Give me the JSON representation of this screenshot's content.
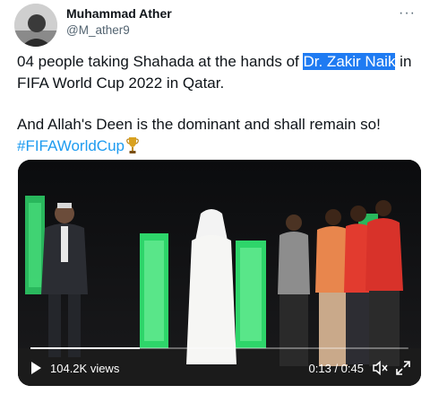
{
  "author": {
    "name": "Muhammad Ather",
    "handle": "@M_ather9",
    "avatar_icon": "profile-photo"
  },
  "menu": {
    "icon": "more-icon",
    "glyph": "···"
  },
  "tweet": {
    "text_before": "04 people taking Shahada at the hands of ",
    "highlight": "Dr. Zakir Naik",
    "text_after": " in FIFA World Cup 2022 in Qatar.",
    "line2": "And Allah's Deen is the dominant and shall remain so!",
    "hashtag": "#FIFAWorldCup",
    "emoji_icon": "trophy-icon"
  },
  "video": {
    "views": "104.2K views",
    "time": "0:13 / 0:45",
    "progress": 0.29,
    "play_icon": "play-icon",
    "volume_icon": "volume-muted-icon",
    "fullscreen_icon": "fullscreen-icon"
  },
  "colors": {
    "text": "#0f1419",
    "secondary": "#536471",
    "link": "#1d9bf0",
    "highlight": "#1f7bf2",
    "stage_green": "#2ed56a",
    "shirt_red": "#e23b2f"
  }
}
